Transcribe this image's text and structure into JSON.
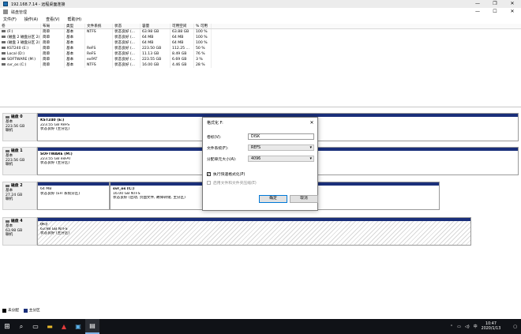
{
  "rdp": {
    "title": "192.168.7.14 - 远程桌面连接"
  },
  "window": {
    "title": "磁盘管理"
  },
  "menu": [
    "文件(F)",
    "操作(A)",
    "查看(V)",
    "帮助(H)"
  ],
  "volume_table": {
    "columns": [
      "卷",
      "布局",
      "类型",
      "文件系统",
      "状态",
      "容量",
      "可用空间",
      "% 可用"
    ],
    "rows": [
      [
        "(F:)",
        "简单",
        "基本",
        "NTFS",
        "状态良好 (...",
        "63.98 GB",
        "63.88 GB",
        "100 %"
      ],
      [
        "(磁盘 2 磁盘分区 2)",
        "简单",
        "基本",
        "",
        "状态良好 (...",
        "64 MB",
        "64 MB",
        "100 %"
      ],
      [
        "(磁盘 3 磁盘分区 2)",
        "简单",
        "基本",
        "",
        "状态良好 (...",
        "64 MB",
        "64 MB",
        "100 %"
      ],
      [
        "KST240 (E:)",
        "简单",
        "基本",
        "ReFS",
        "状态良好 (...",
        "223.50 GB",
        "112.25 ...",
        "50 %"
      ],
      [
        "Local (D:)",
        "简单",
        "基本",
        "ReFS",
        "状态良好 (...",
        "11.13 GB",
        "8.49 GB",
        "76 %"
      ],
      [
        "SOFTWARE (M:)",
        "简单",
        "基本",
        "exFAT",
        "状态良好 (...",
        "223.55 GB",
        "6.69 GB",
        "3 %"
      ],
      [
        "svr_os (C:)",
        "简单",
        "基本",
        "NTFS",
        "状态良好 (...",
        "16.00 GB",
        "4.46 GB",
        "28 %"
      ]
    ]
  },
  "disks": [
    {
      "name": "磁盘 0",
      "kind": "基本",
      "size": "223.56 GB",
      "state": "联机",
      "partitions": [
        {
          "title": "KST240 (E:)",
          "detail": "223.55 GB ReFS",
          "status": "状态良好 (主分区)"
        }
      ]
    },
    {
      "name": "磁盘 1",
      "kind": "基本",
      "size": "223.56 GB",
      "state": "联机",
      "partitions": [
        {
          "title": "SOFTWARE (M:)",
          "detail": "223.55 GB exFAT",
          "status": "状态良好 (主分区)"
        }
      ]
    },
    {
      "name": "磁盘 2",
      "kind": "基本",
      "size": "27.24 GB",
      "state": "联机",
      "partitions": [
        {
          "title": "",
          "detail": "64 MB",
          "status": "状态良好 (EFI 系统分区)"
        },
        {
          "title": "svr_os (C:)",
          "detail": "16.00 GB NTFS",
          "status": "状态良好 (启动, 页面文件, 故障转储, 主分区)"
        }
      ]
    },
    {
      "name": "磁盘 4",
      "kind": "基本",
      "size": "63.98 GB",
      "state": "联机",
      "partitions": [
        {
          "title": "(F:)",
          "detail": "63.98 GB NTFS",
          "status": "状态良好 (主分区)"
        }
      ]
    }
  ],
  "legend": [
    "未分配",
    "主分区"
  ],
  "dialog": {
    "title": "格式化 F:",
    "volume_label_label": "卷标(V):",
    "volume_label_value": "DISK",
    "fs_label": "文件系统(F):",
    "fs_value": "REFS",
    "alloc_label": "分配单元大小(A):",
    "alloc_value": "4096",
    "quick_format": "执行快速格式化(P)",
    "compression": "启用文件和文件夹压缩(E)",
    "ok": "确定",
    "cancel": "取消"
  },
  "taskbar": {
    "time": "10:47",
    "date": "2020/1/13"
  }
}
